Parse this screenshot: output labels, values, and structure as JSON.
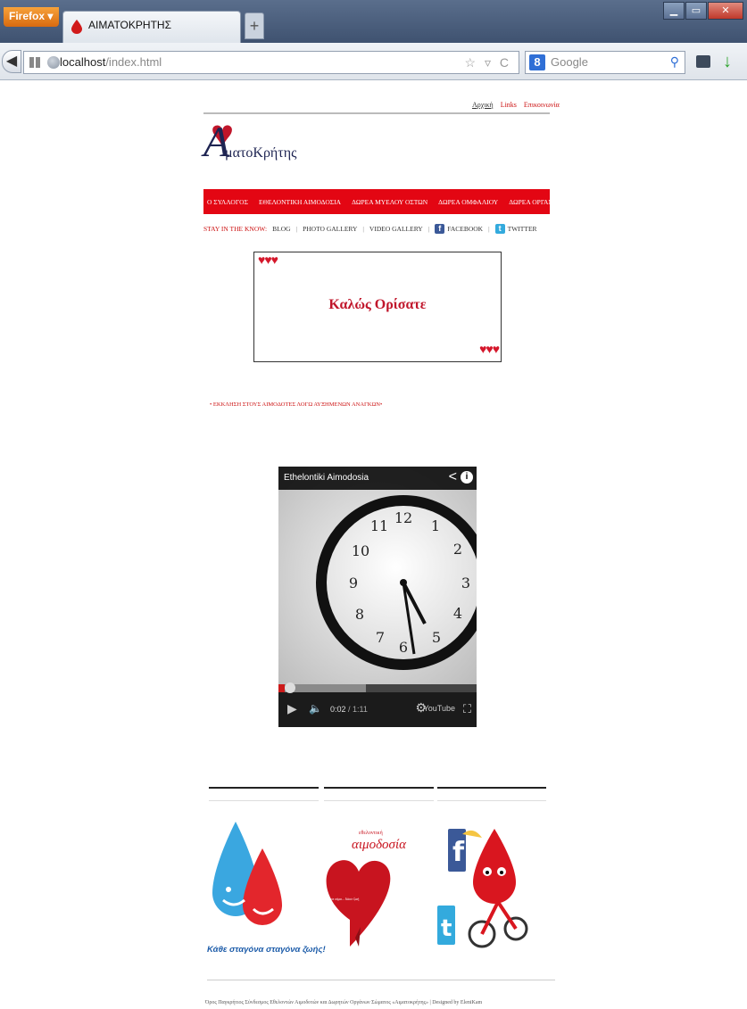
{
  "browser": {
    "menu_button": "Firefox",
    "tab_title": "ΑΙΜΑΤΟΚΡΗΤΗΣ",
    "new_tab": "+",
    "url_host": "localhost",
    "url_path": "/index.html",
    "search_placeholder": "Google",
    "search_engine_letter": "8"
  },
  "site": {
    "top_links": [
      "Αρχική",
      "Links",
      "Επικοινωνία"
    ],
    "logo_letter": "A",
    "logo_text": "ματοΚρήτης",
    "menu": [
      "Ο ΣΥΛΛΟΓΟΣ",
      "ΕΘΕΛΟΝΤΙΚΗ ΑΙΜΟΔΟΣΙΑ",
      "ΔΩΡΕΑ ΜΥΕΛΟΥ ΟΣΤΩΝ",
      "ΔΩΡΕΑ ΟΜΦΑΛΙΟΥ",
      "ΔΩΡΕΑ ΟΡΓΑΝΩΝ"
    ],
    "stay_label": "STAY IN THE KNOW:",
    "stay_links": [
      "BLOG",
      "PHOTO GALLERY",
      "VIDEO GALLERY",
      "FACEBOOK",
      "TWITTER"
    ],
    "welcome": "Καλώς Ορίσατε",
    "urgent": "• ΕΚΚΛΗΣΗ ΣΤΟΥΣ ΑΙΜΟΔΟΤΕΣ ΛΟΓΩ ΑΥΞΗΜΕΝΩΝ ΑΝΑΓΚΩΝ•",
    "video": {
      "title": "Ethelontiki Aimodosia",
      "time_current": "0:02",
      "time_total": "/ 1:11",
      "played_fraction": 0.03,
      "buffered_fraction": 0.44,
      "youtube_label": "YouTube"
    },
    "images": {
      "drop_caption": "Κάθε σταγόνα σταγόνα ζωής!",
      "aimodosia_small": "εθελοντική",
      "aimodosia": "αιμοδοσία",
      "heart_caption": "δώσε αίμα... δώσε ζωή"
    },
    "footer": "Όρος Παγκρήτιος Σύνδεσμος Εθελοντών Αιμοδοτών και Δωρητών Οργάνων Σώματος «Αιματοκρήτης»  |  Designed by EleniKam"
  },
  "colors": {
    "menu_red": "#e30613",
    "heart_red": "#c0152a",
    "logo_navy": "#1e2452"
  }
}
